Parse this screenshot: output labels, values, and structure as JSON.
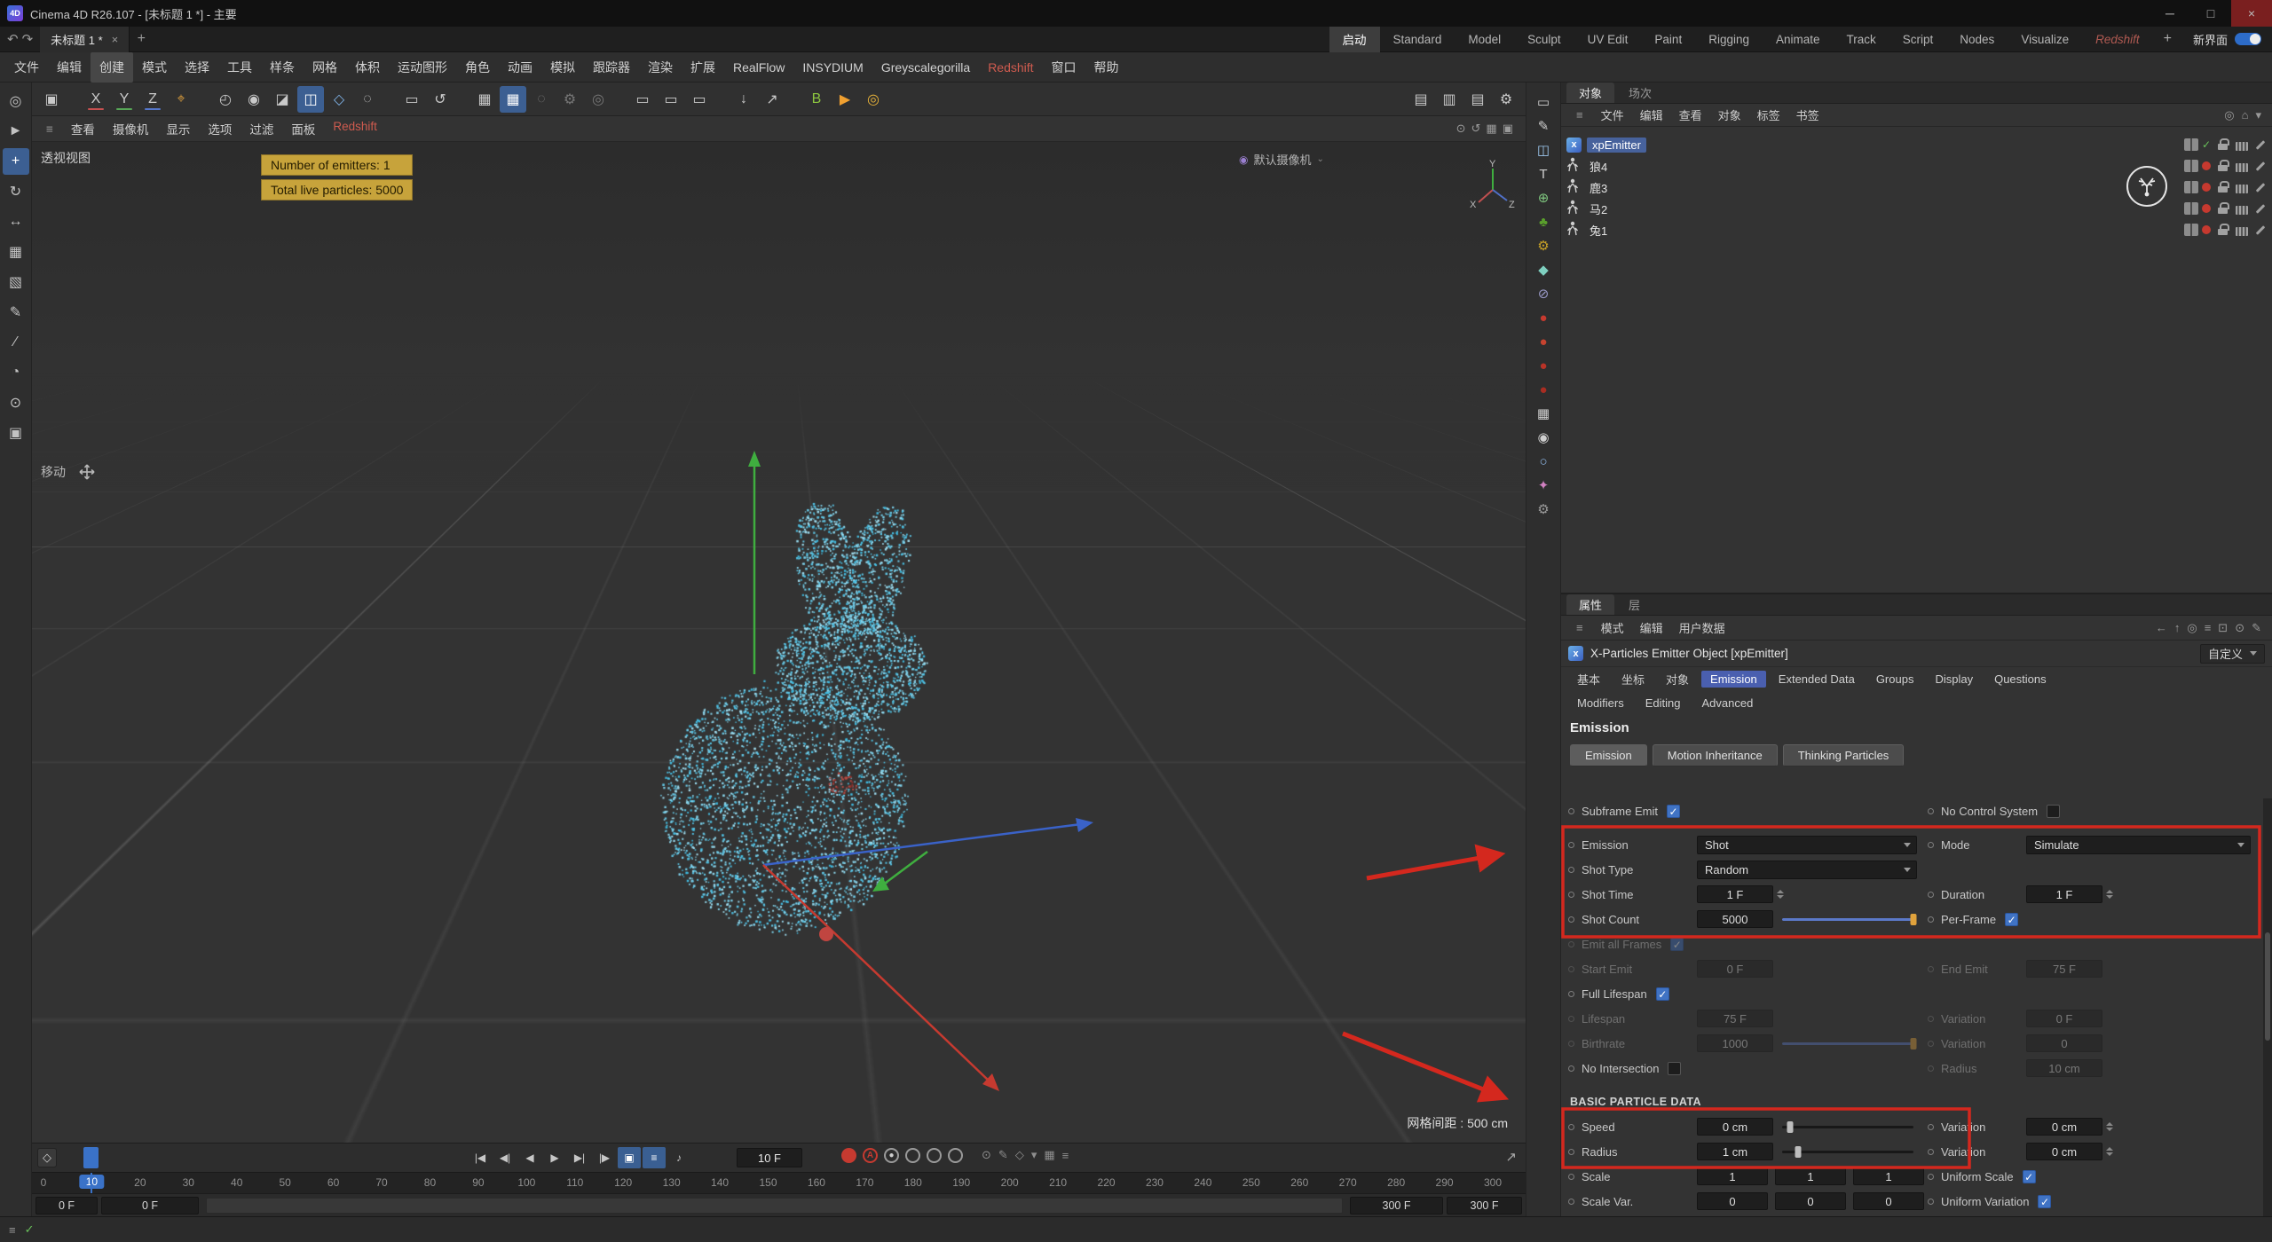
{
  "titlebar": {
    "title": "Cinema 4D R26.107 - [未标题 1 *] - 主要",
    "window_buttons": [
      "─",
      "□",
      "×"
    ]
  },
  "tabbar": {
    "doc_tab": "未标题 1 *",
    "layouts": [
      "启动",
      "Standard",
      "Model",
      "Sculpt",
      "UV Edit",
      "Paint",
      "Rigging",
      "Animate",
      "Track",
      "Script",
      "Nodes",
      "Visualize",
      "Redshift"
    ],
    "active_layout": "启动",
    "redshift_layout": "Redshift",
    "new_ui_label": "新界面"
  },
  "menubar": {
    "items": [
      "文件",
      "编辑",
      "创建",
      "模式",
      "选择",
      "工具",
      "样条",
      "网格",
      "体积",
      "运动图形",
      "角色",
      "动画",
      "模拟",
      "跟踪器",
      "渲染",
      "扩展",
      "RealFlow",
      "INSYDIUM",
      "Greyscalegorilla",
      "Redshift",
      "窗口",
      "帮助"
    ],
    "highlighted": "创建",
    "accented": [
      "Redshift"
    ]
  },
  "left_tools": {
    "icons": [
      {
        "name": "live-selection-tool-icon",
        "g": "◎"
      },
      {
        "name": "select-cursor-tool-icon",
        "g": "►"
      },
      {
        "name": "move-tool-icon",
        "g": "+",
        "active": true
      },
      {
        "name": "rotate-tool-icon",
        "g": "↻"
      },
      {
        "name": "scale-tool-icon",
        "g": "↔"
      },
      {
        "name": "grid-tool-icon",
        "g": "▦"
      },
      {
        "name": "mesh-tool-icon",
        "g": "▧"
      },
      {
        "name": "pen-tool-icon",
        "g": "✎"
      },
      {
        "name": "knife-tool-icon",
        "g": "∕"
      },
      {
        "name": "timer-tool-icon",
        "g": "◔"
      },
      {
        "name": "axis-tool-icon",
        "g": "⊙"
      },
      {
        "name": "workplane-tool-icon",
        "g": "▣"
      }
    ]
  },
  "toolbar": {
    "icons": [
      {
        "name": "viewport-solo-icon",
        "g": "▣"
      },
      {
        "name": "x-axis-lock-button",
        "g": "X",
        "underline": "#c75050",
        "gapBefore": true
      },
      {
        "name": "y-axis-lock-button",
        "g": "Y",
        "underline": "#57a757"
      },
      {
        "name": "z-axis-lock-button",
        "g": "Z",
        "underline": "#5577cc"
      },
      {
        "name": "coord-system-button",
        "g": "⌖",
        "color": "#d79b3c"
      },
      {
        "name": "make-editable-icon",
        "g": "◴",
        "gapBefore": true
      },
      {
        "name": "model-mode-icon",
        "g": "◉"
      },
      {
        "name": "texture-mode-icon",
        "g": "◪"
      },
      {
        "name": "polygon-mode-icon",
        "g": "◫",
        "active": true
      },
      {
        "name": "points-mode-icon",
        "g": "◇",
        "color": "#7fb3e8"
      },
      {
        "name": "edge-mode-icon",
        "g": "◌"
      },
      {
        "name": "workplane-icon",
        "g": "▭",
        "gapBefore": true
      },
      {
        "name": "undo-view-icon",
        "g": "↺"
      },
      {
        "name": "snap-grid-icon",
        "g": "▦",
        "gapBefore": true
      },
      {
        "name": "snap-quantize-icon",
        "g": "▦",
        "active": true
      },
      {
        "name": "snap-off-icon",
        "g": "◌",
        "dim": true
      },
      {
        "name": "snap-gear-icon",
        "g": "⚙",
        "dim": true
      },
      {
        "name": "snap-target-icon",
        "g": "◎",
        "dim": true
      },
      {
        "name": "capsule-a-icon",
        "g": "▭",
        "gapBefore": true
      },
      {
        "name": "capsule-b-icon",
        "g": "▭"
      },
      {
        "name": "capsule-c-icon",
        "g": "▭"
      },
      {
        "name": "asset-download-icon",
        "g": "↓",
        "gapBefore": true
      },
      {
        "name": "asset-export-icon",
        "g": "↗"
      },
      {
        "name": "bullet-badge-icon",
        "g": "B",
        "color": "#8dc63f",
        "gapBefore": true
      },
      {
        "name": "play-badge-icon",
        "g": "▶",
        "color": "#f0a030"
      },
      {
        "name": "target-ring-icon",
        "g": "◎",
        "color": "#e8b33a"
      }
    ],
    "render_icons": [
      {
        "name": "render-view-icon",
        "g": "▤"
      },
      {
        "name": "render-picture-viewer-icon",
        "g": "▥"
      },
      {
        "name": "render-region-icon",
        "g": "▤"
      },
      {
        "name": "render-settings-icon",
        "g": "⚙"
      }
    ]
  },
  "viewport_menu": {
    "items": [
      "查看",
      "摄像机",
      "显示",
      "选项",
      "过滤",
      "面板",
      "Redshift"
    ],
    "accented": [
      "Redshift"
    ],
    "right_icons": [
      {
        "name": "vp-target-icon",
        "g": "⊙"
      },
      {
        "name": "vp-undo-icon",
        "g": "↺"
      },
      {
        "name": "vp-grid-icon",
        "g": "▦"
      },
      {
        "name": "vp-layout-icon",
        "g": "▣"
      }
    ]
  },
  "viewport": {
    "label": "透视视图",
    "camera_label": "默认摄像机",
    "tool_label": "移动",
    "info_box": [
      "Number of emitters: 1",
      "Total live particles: 5000"
    ],
    "grid_spacing": "网格间距 : 500 cm",
    "axis_labels": {
      "y": "Y",
      "x": "X",
      "z": "Z"
    }
  },
  "timeline": {
    "current_frame": "10 F",
    "marker_frame": "10",
    "ticks": [
      "0",
      "10",
      "20",
      "30",
      "40",
      "50",
      "60",
      "70",
      "80",
      "90",
      "100",
      "110",
      "120",
      "130",
      "140",
      "150",
      "160",
      "170",
      "180",
      "190",
      "200",
      "210",
      "220",
      "230",
      "240",
      "250",
      "260",
      "270",
      "280",
      "290",
      "300"
    ],
    "keyframe_button": "◇",
    "transport": [
      {
        "name": "goto-start-button",
        "g": "|◀"
      },
      {
        "name": "prev-key-button",
        "g": "◀|"
      },
      {
        "name": "prev-frame-button",
        "g": "◀"
      },
      {
        "name": "play-button",
        "g": "▶"
      },
      {
        "name": "next-frame-button",
        "g": "▶|"
      },
      {
        "name": "goto-end-button",
        "g": "|▶"
      },
      {
        "name": "point-anim-toggle",
        "g": "▣",
        "blue": true
      },
      {
        "name": "param-anim-toggle",
        "g": "≡",
        "blue": true
      },
      {
        "name": "sound-toggle",
        "g": "♪"
      }
    ],
    "records": [
      {
        "name": "record-keyframe-button",
        "cls": "rec",
        "g": ""
      },
      {
        "name": "autokey-button",
        "cls": "reca",
        "g": "A"
      },
      {
        "name": "record-position-toggle",
        "cls": "ring",
        "g": "●"
      },
      {
        "name": "record-scale-toggle",
        "cls": "ring",
        "g": ""
      },
      {
        "name": "record-rotation-toggle",
        "cls": "ring",
        "g": ""
      },
      {
        "name": "record-pla-toggle",
        "cls": "ring",
        "g": ""
      }
    ],
    "extra_icons": [
      {
        "name": "keyframe-selection-icon",
        "g": "⊙"
      },
      {
        "name": "keyframe-pen-icon",
        "g": "✎"
      },
      {
        "name": "keyframe-diamond-icon",
        "g": "◇"
      },
      {
        "name": "timeline-options-icon",
        "g": "▾"
      },
      {
        "name": "timeline-grid-icon",
        "g": "▦"
      },
      {
        "name": "timeline-menu-icon",
        "g": "≡"
      }
    ],
    "zoom_icon": "↗",
    "range_fields": {
      "start_a": "0 F",
      "start_b": "0 F",
      "end_a": "300 F",
      "end_b": "300 F"
    }
  },
  "object_palette": {
    "icons": [
      {
        "name": "cube-object-icon",
        "g": "▭",
        "c": "#cfcfcf"
      },
      {
        "name": "spline-pen-icon",
        "g": "✎",
        "c": "#cfcfcf"
      },
      {
        "name": "generator-icon",
        "g": "◫",
        "c": "#9ec8f0"
      },
      {
        "name": "text-object-icon",
        "g": "T",
        "c": "#cfcfcf"
      },
      {
        "name": "field-icon",
        "g": "⊕",
        "c": "#7fc77f"
      },
      {
        "name": "scene-nature-icon",
        "g": "♣",
        "c": "#5aa02c"
      },
      {
        "name": "gear-deformer-icon",
        "g": "⚙",
        "c": "#c9a227"
      },
      {
        "name": "mograph-icon",
        "g": "◆",
        "c": "#7fd0c0"
      },
      {
        "name": "falloff-icon",
        "g": "⊘",
        "c": "#9a9ac8"
      },
      {
        "name": "rs-material-1-icon",
        "g": "●",
        "c": "#c63a2f"
      },
      {
        "name": "rs-material-2-icon",
        "g": "●",
        "c": "#c6432f"
      },
      {
        "name": "rs-material-3-icon",
        "g": "●",
        "c": "#b83327"
      },
      {
        "name": "rs-material-4-icon",
        "g": "●",
        "c": "#a82d22"
      },
      {
        "name": "render-node-icon",
        "g": "▦",
        "c": "#cfcfcf"
      },
      {
        "name": "camera-object-icon",
        "g": "◉",
        "c": "#cfcfcf"
      },
      {
        "name": "environment-icon",
        "g": "○",
        "c": "#8fb8e8"
      },
      {
        "name": "paint-icon",
        "g": "✦",
        "c": "#d080c0"
      },
      {
        "name": "settings-wrench-icon",
        "g": "⚙",
        "c": "#9a9a9a"
      }
    ]
  },
  "object_manager": {
    "tabs": [
      "对象",
      "场次"
    ],
    "active_tab": "对象",
    "menu": [
      "文件",
      "编辑",
      "查看",
      "对象",
      "标签",
      "书签"
    ],
    "right_icons": [
      {
        "name": "om-search-icon",
        "g": "◎"
      },
      {
        "name": "om-home-icon",
        "g": "⌂"
      },
      {
        "name": "om-filter-icon",
        "g": "▾"
      }
    ],
    "objects": [
      {
        "name": "xpEmitter",
        "selected": true,
        "kind": "emitter",
        "status": "check"
      },
      {
        "name": "狼4",
        "kind": "figure",
        "status": "dot"
      },
      {
        "name": "鹿3",
        "kind": "figure",
        "status": "dot"
      },
      {
        "name": "马2",
        "kind": "figure",
        "status": "dot"
      },
      {
        "name": "兔1",
        "kind": "figure",
        "status": "dot"
      }
    ]
  },
  "attribute_manager": {
    "tabs": [
      "属性",
      "层"
    ],
    "active_tab": "属性",
    "menu": [
      "模式",
      "编辑",
      "用户数据"
    ],
    "right_icons": [
      {
        "name": "am-back-icon",
        "g": "←"
      },
      {
        "name": "am-up-icon",
        "g": "↑"
      },
      {
        "name": "am-search-icon",
        "g": "◎"
      },
      {
        "name": "am-menu-icon",
        "g": "≡"
      },
      {
        "name": "am-lock-icon",
        "g": "⊡"
      },
      {
        "name": "am-track-icon",
        "g": "⊙"
      },
      {
        "name": "am-edit-icon",
        "g": "✎"
      }
    ],
    "object_title": "X-Particles Emitter Object [xpEmitter]",
    "preset_label": "自定义",
    "section_tabs_row1": [
      "基本",
      "坐标",
      "对象",
      "Emission",
      "Extended Data",
      "Groups",
      "Display",
      "Questions"
    ],
    "section_tabs_row2": [
      "Modifiers",
      "Editing",
      "Advanced"
    ],
    "active_section": "Emission",
    "heading": "Emission",
    "sub_tabs": [
      "Emission",
      "Motion Inheritance",
      "Thinking Particles"
    ],
    "active_sub": "Emission",
    "rows": [
      {
        "gap_after": true,
        "left": {
          "type": "check",
          "label": "Subframe Emit",
          "checked": true
        },
        "right": {
          "type": "check",
          "label": "No Control System",
          "checked": false
        }
      },
      {
        "left": {
          "type": "dropdown",
          "label": "Emission",
          "value": "Shot"
        },
        "right": {
          "type": "dropdown",
          "label": "Mode",
          "value": "Simulate"
        }
      },
      {
        "left": {
          "type": "dropdown",
          "label": "Shot Type",
          "value": "Random"
        },
        "right": {
          "type": "empty"
        }
      },
      {
        "left": {
          "type": "field",
          "label": "Shot Time",
          "value": "1 F",
          "spin": true
        },
        "right": {
          "type": "field",
          "label": "Duration",
          "value": "1 F",
          "spin": true
        }
      },
      {
        "left": {
          "type": "slider",
          "label": "Shot Count",
          "value": "5000",
          "pos": 1,
          "fill": true,
          "handle": "#e0a23c"
        },
        "right": {
          "type": "check",
          "label": "Per-Frame",
          "checked": true
        }
      },
      {
        "left": {
          "type": "check",
          "label": "Emit all Frames",
          "checked": true,
          "disabled": true
        },
        "right": {
          "type": "empty"
        }
      },
      {
        "left": {
          "type": "field",
          "label": "Start Emit",
          "value": "0 F",
          "disabled": true
        },
        "right": {
          "type": "field",
          "label": "End Emit",
          "value": "75 F",
          "disabled": true
        }
      },
      {
        "left": {
          "type": "check",
          "label": "Full Lifespan",
          "checked": true
        },
        "right": {
          "type": "empty"
        }
      },
      {
        "left": {
          "type": "field",
          "label": "Lifespan",
          "value": "75 F",
          "disabled": true
        },
        "right": {
          "type": "field",
          "label": "Variation",
          "value": "0 F",
          "disabled": true
        }
      },
      {
        "left": {
          "type": "slider",
          "label": "Birthrate",
          "value": "1000",
          "pos": 1,
          "fill": true,
          "handle": "#e0a23c",
          "disabled": true
        },
        "right": {
          "type": "field",
          "label": "Variation",
          "value": "0",
          "disabled": true
        }
      },
      {
        "left": {
          "type": "check",
          "label": "No Intersection",
          "checked": false
        },
        "right": {
          "type": "field",
          "label": "Radius",
          "value": "10 cm",
          "disabled": true
        }
      },
      {
        "header": "BASIC PARTICLE DATA"
      },
      {
        "left": {
          "type": "slider",
          "label": "Speed",
          "value": "0 cm",
          "pos": 0.06,
          "handle": "#bdbdbd"
        },
        "right": {
          "type": "field",
          "label": "Variation",
          "value": "0 cm",
          "spin": true
        }
      },
      {
        "left": {
          "type": "slider",
          "label": "Radius",
          "value": "1 cm",
          "pos": 0.12,
          "handle": "#bdbdbd"
        },
        "right": {
          "type": "field",
          "label": "Variation",
          "value": "0 cm",
          "spin": true
        }
      },
      {
        "left": {
          "type": "triple",
          "label": "Scale",
          "values": [
            "1",
            "1",
            "1"
          ]
        },
        "right": {
          "type": "check",
          "label": "Uniform Scale",
          "checked": true
        }
      },
      {
        "left": {
          "type": "triple",
          "label": "Scale Var.",
          "values": [
            "0",
            "0",
            "0"
          ]
        },
        "right": {
          "type": "check",
          "label": "Uniform Variation",
          "checked": true
        }
      }
    ]
  },
  "statusbar": {
    "icons": [
      "≡",
      "✓"
    ]
  },
  "annotation_color": "#d4281e"
}
